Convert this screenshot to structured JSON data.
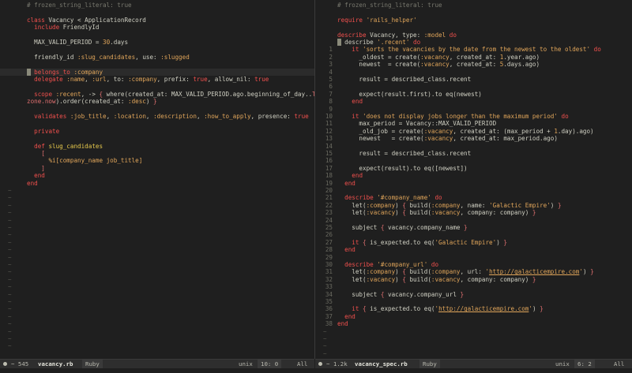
{
  "left": {
    "lines": [
      {
        "n": "",
        "html": "<span class=\"c\"># frozen_string_literal: true</span>"
      },
      {
        "n": "",
        "html": ""
      },
      {
        "n": "",
        "html": "<span class=\"k\">class</span> Vacancy &lt; ApplicationRecord"
      },
      {
        "n": "",
        "html": "  <span class=\"k\">include</span> FriendlyId"
      },
      {
        "n": "",
        "html": ""
      },
      {
        "n": "",
        "html": "  MAX_VALID_PERIOD = <span class=\"s\">30</span>.days"
      },
      {
        "n": "",
        "html": ""
      },
      {
        "n": "",
        "html": "  friendly_id <span class=\"s\">:slug_candidates</span>, use: <span class=\"s\">:slugged</span>"
      },
      {
        "n": "",
        "html": ""
      },
      {
        "n": "",
        "html": "<span class=\"cur\"> </span> <span class=\"k\">belongs_to</span> <span class=\"s\">:company</span>",
        "hl": true
      },
      {
        "n": "",
        "html": "  <span class=\"k\">delegate</span> <span class=\"s\">:name</span>, <span class=\"s\">:url</span>, to: <span class=\"s\">:company</span>, prefix: <span class=\"k\">true</span>, allow_nil: <span class=\"k\">true</span>"
      },
      {
        "n": "",
        "html": ""
      },
      {
        "n": "",
        "html": "  <span class=\"k\">scope</span> <span class=\"s\">:recent</span>, -&gt; <span class=\"p\">{</span> where(created_at: MAX_VALID_PERIOD.ago.beginning_of_day..<span class=\"err\">Time.</span>"
      },
      {
        "n": "",
        "html": "<span class=\"err\">zone.now</span>).order(created_at: <span class=\"s\">:desc</span>) <span class=\"p\">}</span>"
      },
      {
        "n": "",
        "html": ""
      },
      {
        "n": "",
        "html": "  <span class=\"k\">validates</span> <span class=\"s\">:job_title</span>, <span class=\"s\">:location</span>, <span class=\"s\">:description</span>, <span class=\"s\">:how_to_apply</span>, presence: <span class=\"k\">true</span>"
      },
      {
        "n": "",
        "html": ""
      },
      {
        "n": "",
        "html": "  <span class=\"k\">private</span>"
      },
      {
        "n": "",
        "html": ""
      },
      {
        "n": "",
        "html": "  <span class=\"k\">def</span> <span class=\"y\">slug_candidates</span>"
      },
      {
        "n": "",
        "html": "    <span class=\"p\">[</span>"
      },
      {
        "n": "",
        "html": "      <span class=\"s\">%i[company_name job_title]</span>"
      },
      {
        "n": "",
        "html": "    <span class=\"p\">]</span>"
      },
      {
        "n": "",
        "html": "  <span class=\"k\">end</span>"
      },
      {
        "n": "",
        "html": "<span class=\"k\">end</span>"
      }
    ],
    "tilde_count": 22,
    "status": {
      "info": "~ 545",
      "file": "vacancy.rb",
      "filetype": "Ruby",
      "format": "unix",
      "position": "10: 0",
      "scroll": "All"
    }
  },
  "right": {
    "lines": [
      {
        "n": "",
        "html": "<span class=\"c\"># frozen_string_literal: true</span>"
      },
      {
        "n": "",
        "html": ""
      },
      {
        "n": "",
        "html": "<span class=\"k\">require</span> <span class=\"s\">'rails_helper'</span>"
      },
      {
        "n": "",
        "html": ""
      },
      {
        "n": "",
        "html": "<span class=\"k\">describe</span> Vacancy, type: <span class=\"s\">:model</span> <span class=\"k\">do</span>"
      },
      {
        "n": "",
        "html": "<span class=\"cur\"> </span> describe <span class=\"s\">'.recent'</span> <span class=\"k\">do</span>"
      },
      {
        "n": "1",
        "html": "    <span class=\"k\">it</span> <span class=\"s\">'sorts the vacancies by the date from the newest to the oldest'</span> <span class=\"k\">do</span>"
      },
      {
        "n": "2",
        "html": "      _oldest = create(<span class=\"s\">:vacancy</span>, created_at: <span class=\"s\">1</span>.year.ago)"
      },
      {
        "n": "3",
        "html": "      newest  = create(<span class=\"s\">:vacancy</span>, created_at: <span class=\"s\">5</span>.days.ago)"
      },
      {
        "n": "4",
        "html": ""
      },
      {
        "n": "5",
        "html": "      result = described_class.recent"
      },
      {
        "n": "6",
        "html": ""
      },
      {
        "n": "7",
        "html": "      expect(result.first).to eq(newest)"
      },
      {
        "n": "8",
        "html": "    <span class=\"k\">end</span>"
      },
      {
        "n": "9",
        "html": ""
      },
      {
        "n": "10",
        "html": "    <span class=\"k\">it</span> <span class=\"s\">'does not display jobs longer than the maximum period'</span> <span class=\"k\">do</span>"
      },
      {
        "n": "11",
        "html": "      max_period = Vacancy::MAX_VALID_PERIOD"
      },
      {
        "n": "12",
        "html": "      _old_job = create(<span class=\"s\">:vacancy</span>, created_at: (max_period + <span class=\"s\">1</span>.day).ago)"
      },
      {
        "n": "13",
        "html": "      newest   = create(<span class=\"s\">:vacancy</span>, created_at: max_period.ago)"
      },
      {
        "n": "14",
        "html": ""
      },
      {
        "n": "15",
        "html": "      result = described_class.recent"
      },
      {
        "n": "16",
        "html": ""
      },
      {
        "n": "17",
        "html": "      expect(result).to eq([newest])"
      },
      {
        "n": "18",
        "html": "    <span class=\"k\">end</span>"
      },
      {
        "n": "19",
        "html": "  <span class=\"k\">end</span>"
      },
      {
        "n": "20",
        "html": ""
      },
      {
        "n": "21",
        "html": "  <span class=\"k\">describe</span> <span class=\"s\">'#company_name'</span> <span class=\"k\">do</span>"
      },
      {
        "n": "22",
        "html": "    let(<span class=\"s\">:company</span>) <span class=\"p\">{</span> build(<span class=\"s\">:company</span>, name: <span class=\"s\">'Galactic Empire'</span>) <span class=\"p\">}</span>"
      },
      {
        "n": "23",
        "html": "    let(<span class=\"s\">:vacancy</span>) <span class=\"p\">{</span> build(<span class=\"s\">:vacancy</span>, company: company) <span class=\"p\">}</span>"
      },
      {
        "n": "24",
        "html": ""
      },
      {
        "n": "25",
        "html": "    subject <span class=\"p\">{</span> vacancy.company_name <span class=\"p\">}</span>"
      },
      {
        "n": "26",
        "html": ""
      },
      {
        "n": "27",
        "html": "    <span class=\"k\">it</span> <span class=\"p\">{</span> is_expected.to eq(<span class=\"s\">'Galactic Empire'</span>) <span class=\"p\">}</span>"
      },
      {
        "n": "28",
        "html": "  <span class=\"k\">end</span>"
      },
      {
        "n": "29",
        "html": ""
      },
      {
        "n": "30",
        "html": "  <span class=\"k\">describe</span> <span class=\"s\">'#company_url'</span> <span class=\"k\">do</span>"
      },
      {
        "n": "31",
        "html": "    let(<span class=\"s\">:company</span>) <span class=\"p\">{</span> build(<span class=\"s\">:company</span>, url: <span class=\"s\">'</span><span class=\"u\">http://galacticempire.com</span><span class=\"s\">'</span>) <span class=\"p\">}</span>"
      },
      {
        "n": "32",
        "html": "    let(<span class=\"s\">:vacancy</span>) <span class=\"p\">{</span> build(<span class=\"s\">:vacancy</span>, company: company) <span class=\"p\">}</span>"
      },
      {
        "n": "33",
        "html": ""
      },
      {
        "n": "34",
        "html": "    subject <span class=\"p\">{</span> vacancy.company_url <span class=\"p\">}</span>"
      },
      {
        "n": "35",
        "html": ""
      },
      {
        "n": "36",
        "html": "    <span class=\"k\">it</span> <span class=\"p\">{</span> is_expected.to eq(<span class=\"s\">'</span><span class=\"u\">http://galacticempire.com</span><span class=\"s\">'</span>) <span class=\"p\">}</span>"
      },
      {
        "n": "37",
        "html": "  <span class=\"k\">end</span>"
      },
      {
        "n": "38",
        "html": "<span class=\"k\">end</span>"
      }
    ],
    "tilde_count": 4,
    "status": {
      "info": "~ 1.2k",
      "file": "vacancy_spec.rb",
      "filetype": "Ruby",
      "format": "unix",
      "position": "6: 2",
      "scroll": "All"
    }
  }
}
